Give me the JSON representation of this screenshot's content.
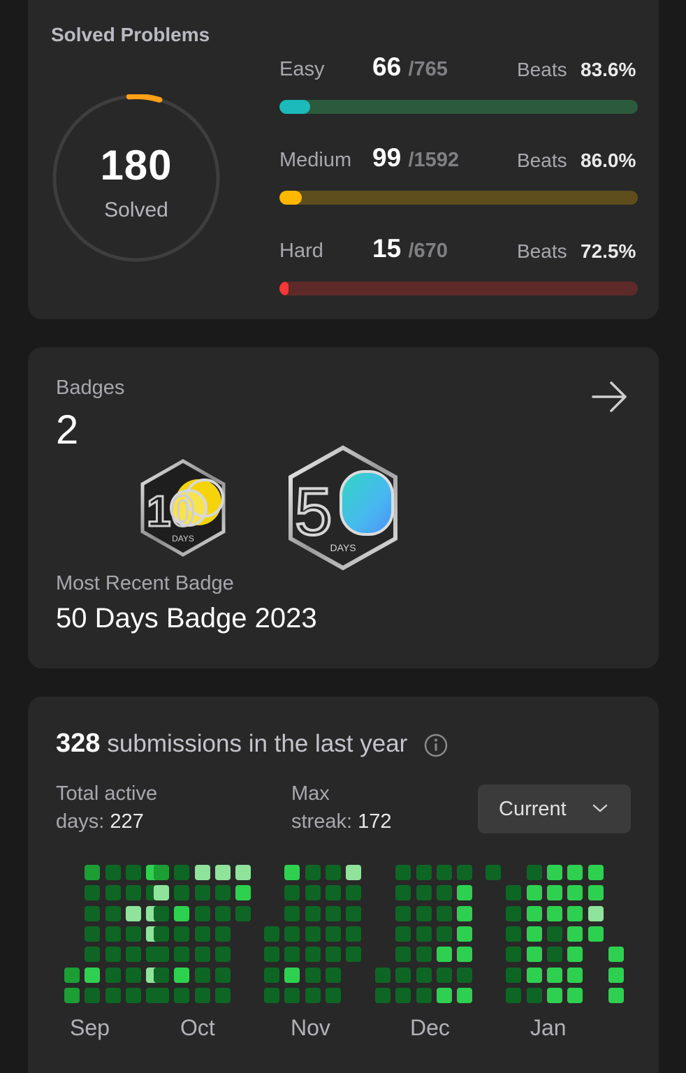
{
  "solved": {
    "title": "Solved Problems",
    "total": "180",
    "total_label": "Solved",
    "progress_fraction": 0.06,
    "rows": [
      {
        "label": "Easy",
        "count": "66",
        "total": "/765",
        "beats_label": "Beats",
        "beats": "83.6%",
        "fraction": 0.086,
        "color": "#1cbaba",
        "track": "#2c5a3c"
      },
      {
        "label": "Medium",
        "count": "99",
        "total": "/1592",
        "beats_label": "Beats",
        "beats": "86.0%",
        "fraction": 0.062,
        "color": "#ffb700",
        "track": "#5e4e1d"
      },
      {
        "label": "Hard",
        "count": "15",
        "total": "/670",
        "beats_label": "Beats",
        "beats": "72.5%",
        "fraction": 0.022,
        "color": "#f63737",
        "track": "#5e2a29"
      }
    ]
  },
  "badges": {
    "title": "Badges",
    "count": "2",
    "items": [
      {
        "numeral": "10",
        "caption": "DAYS",
        "icon": "100-days-badge-icon"
      },
      {
        "numeral": "5",
        "caption": "DAYS",
        "icon": "50-days-badge-icon"
      }
    ],
    "recent_label": "Most Recent Badge",
    "recent_name": "50 Days Badge 2023"
  },
  "submissions": {
    "count": "328",
    "text": "submissions in the last year",
    "active_label_1": "Total active",
    "active_label_2": "days:",
    "active_value": "227",
    "streak_label_1": "Max",
    "streak_label_2": "streak:",
    "streak_value": "172",
    "dropdown_value": "Current",
    "months": [
      "Sep",
      "Oct",
      "Nov",
      "Dec",
      "Jan"
    ],
    "heatmap_colors": {
      "1": "#0e6624",
      "2": "#1b9e34",
      "3": "#2ed14f",
      "4": "#8fe39b"
    },
    "heatmap": [
      {
        "col_start": 0,
        "cols": [
          [
            0,
            0,
            0,
            0,
            0,
            2,
            2
          ],
          [
            2,
            1,
            1,
            1,
            1,
            3,
            1
          ],
          [
            1,
            1,
            1,
            1,
            1,
            1,
            1
          ],
          [
            1,
            1,
            4,
            1,
            1,
            1,
            1
          ],
          [
            3,
            1,
            4,
            4,
            1,
            4,
            1
          ]
        ]
      },
      {
        "col_start": 5,
        "cols": [
          [
            2,
            4,
            1,
            1,
            1,
            1,
            1
          ],
          [
            1,
            1,
            3,
            1,
            1,
            3,
            1
          ],
          [
            4,
            1,
            1,
            1,
            1,
            1,
            1
          ],
          [
            4,
            1,
            1,
            1,
            1,
            1,
            1
          ],
          [
            4,
            3,
            1,
            0,
            0,
            0,
            0
          ]
        ]
      },
      {
        "col_start": 10,
        "cols": [
          [
            0,
            0,
            0,
            1,
            1,
            1,
            1
          ],
          [
            3,
            1,
            1,
            1,
            1,
            3,
            1
          ],
          [
            1,
            1,
            1,
            1,
            1,
            1,
            1
          ],
          [
            1,
            1,
            1,
            1,
            1,
            1,
            1
          ],
          [
            4,
            1,
            1,
            1,
            1,
            0,
            0
          ]
        ]
      },
      {
        "col_start": 15,
        "cols": [
          [
            0,
            0,
            0,
            0,
            0,
            1,
            1
          ],
          [
            1,
            1,
            1,
            1,
            1,
            1,
            1
          ],
          [
            1,
            1,
            1,
            1,
            1,
            1,
            1
          ],
          [
            1,
            1,
            1,
            1,
            3,
            1,
            3
          ],
          [
            1,
            3,
            3,
            3,
            3,
            1,
            3
          ]
        ]
      },
      {
        "col_start": 20,
        "cols": [
          [
            1,
            0,
            0,
            0,
            0,
            0,
            0
          ],
          [
            0,
            1,
            1,
            1,
            1,
            1,
            1
          ],
          [
            1,
            3,
            3,
            3,
            3,
            3,
            1
          ],
          [
            3,
            3,
            3,
            1,
            1,
            3,
            3
          ],
          [
            3,
            3,
            3,
            3,
            3,
            3,
            3
          ],
          [
            3,
            3,
            4,
            3,
            0,
            0,
            0
          ],
          [
            0,
            0,
            0,
            0,
            3,
            3,
            3
          ]
        ]
      }
    ]
  }
}
